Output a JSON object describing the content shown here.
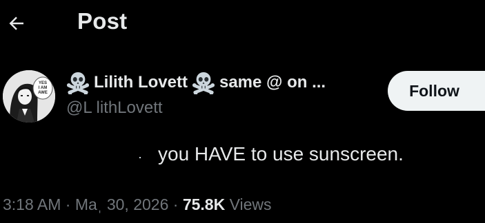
{
  "header": {
    "title": "Post",
    "back_icon": "arrow-left-icon"
  },
  "author": {
    "display_name": "Lilith Lovett",
    "name_suffix": "same @ on ...",
    "handle": "@L lithLovett",
    "badge_icon": "skull-crossbones-icon",
    "avatar_text": "YES I AM AWE"
  },
  "follow": {
    "label": "Follow"
  },
  "post": {
    "text": "you HAVE to use sunscreen."
  },
  "meta": {
    "time": "3:18 AM",
    "separator": "·",
    "date": "Maˌ 30, 2026",
    "views_count": "75.8K",
    "views_label": "Views"
  },
  "colors": {
    "background": "#000000",
    "primary_text": "#e7e9ea",
    "secondary_text": "#71767b",
    "button_bg": "#eff3f4",
    "button_text": "#0f1419"
  }
}
